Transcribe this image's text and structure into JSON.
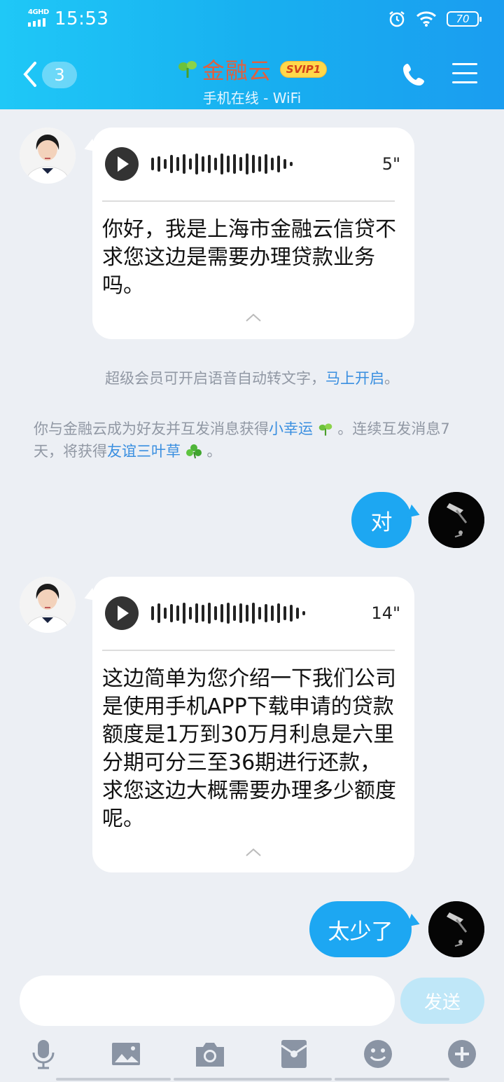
{
  "status_bar": {
    "network": "4GHD",
    "time": "15:53",
    "battery": "70"
  },
  "header": {
    "back_count": "3",
    "title": "金融云",
    "badge": "SVIP1",
    "subtitle": "手机在线 - WiFi"
  },
  "messages": {
    "m1": {
      "duration": "5\"",
      "text": "你好，我是上海市金融云信贷不求您这边是需要办理贷款业务吗。"
    },
    "sys1": {
      "text": "超级会员可开启语音自动转文字，",
      "link": "马上开启",
      "end": "。"
    },
    "sys2": {
      "a": "你与金融云成为好友并互发消息获得",
      "link1": "小幸运",
      "b": "。连续互发消息7天，将获得",
      "link2": "友谊三叶草",
      "c": "。"
    },
    "m2": {
      "text": "对"
    },
    "m3": {
      "duration": "14\"",
      "text": "这边简单为您介绍一下我们公司是使用手机APP下载申请的贷款额度是1万到30万月利息是六里分期可分三至36期进行还款，求您这边大概需要办理多少额度呢。"
    },
    "m4": {
      "text": "太少了"
    }
  },
  "input": {
    "placeholder": "",
    "send_label": "发送"
  },
  "toolbar": {
    "items": [
      "microphone-icon",
      "image-icon",
      "camera-icon",
      "red-packet-icon",
      "emoji-icon",
      "plus-icon"
    ]
  },
  "colors": {
    "header": "#1fb8f5",
    "bubble_out": "#1da7f2",
    "link": "#3a8fe0",
    "title": "#e0603f"
  }
}
